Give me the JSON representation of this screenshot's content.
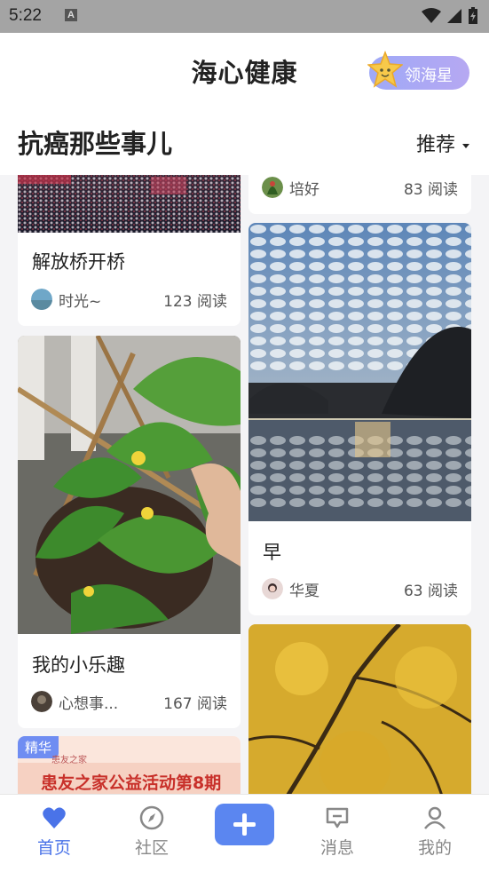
{
  "status_bar": {
    "time": "5:22",
    "notification_letter": "A"
  },
  "header": {
    "title": "海心健康",
    "star_button_label": "领海星"
  },
  "section": {
    "title": "抗癌那些事儿",
    "sort_label": "推荐"
  },
  "feed": {
    "left": [
      {
        "title": "解放桥开桥",
        "author": "时光~",
        "reads": "123 阅读"
      },
      {
        "title": "我的小乐趣",
        "author": "心想事...",
        "reads": "167 阅读"
      },
      {
        "badge": "精华",
        "banner_small": "患友之家",
        "banner_text": "患友之家公益活动第8期"
      }
    ],
    "right": [
      {
        "author": "培好",
        "reads": "83 阅读"
      },
      {
        "title": "早",
        "author": "华夏",
        "reads": "63 阅读"
      },
      {}
    ]
  },
  "tabbar": {
    "items": [
      {
        "label": "首页",
        "active": true
      },
      {
        "label": "社区"
      },
      {
        "label": ""
      },
      {
        "label": "消息"
      },
      {
        "label": "我的"
      }
    ]
  },
  "colors": {
    "accent": "#4a73e8",
    "plus_button": "#5b86f0",
    "star_button": "#a8a8f4"
  }
}
